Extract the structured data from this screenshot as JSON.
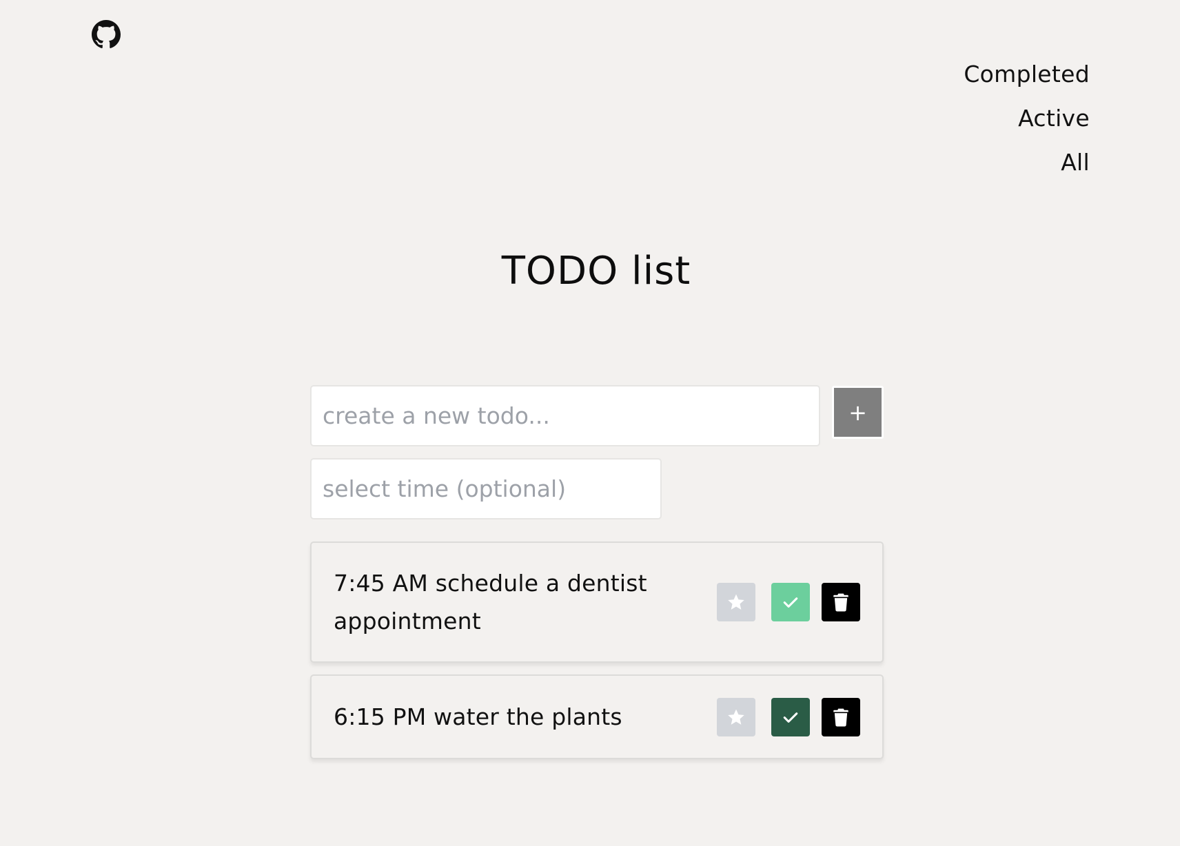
{
  "header": {
    "github_icon": "github-icon"
  },
  "filters": [
    {
      "label": "Completed"
    },
    {
      "label": "Active"
    },
    {
      "label": "All"
    }
  ],
  "main": {
    "title": "TODO list",
    "new_todo_placeholder": "create a new todo...",
    "time_placeholder": "select time (optional)",
    "add_label": "+"
  },
  "todos": [
    {
      "text": "7:45 AM schedule a dentist appointment",
      "starred": false,
      "completed": false
    },
    {
      "text": "6:15 PM water the plants",
      "starred": false,
      "completed": true
    }
  ],
  "icons": {
    "star": "star-icon",
    "check": "check-icon",
    "delete": "trash-icon"
  },
  "colors": {
    "background": "#f3f1ef",
    "star_button": "#d2d5da",
    "check_active": "#6ccf9d",
    "check_completed": "#2a5c46",
    "delete_button": "#000000",
    "add_button": "#7f7f7f"
  }
}
